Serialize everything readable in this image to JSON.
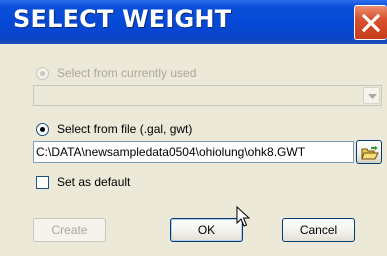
{
  "window": {
    "title": "SELECT WEIGHT"
  },
  "options": {
    "currently_used_label": "Select from currently used",
    "currently_used_value": "",
    "from_file_label": "Select from file (.gal, gwt)",
    "file_path": "C:\\DATA\\newsampledata0504\\ohiolung\\ohk8.GWT",
    "selected_option": "from_file"
  },
  "default_checkbox": {
    "label": "Set as default",
    "checked": false
  },
  "buttons": {
    "create": "Create",
    "ok": "OK",
    "cancel": "Cancel"
  },
  "icons": {
    "close": "close-icon",
    "dropdown": "chevron-down-icon",
    "browse": "folder-open-icon",
    "cursor": "mouse-pointer-icon"
  },
  "colors": {
    "title_bar": "#0548d6",
    "close_button": "#d9502e",
    "dialog_background": "#ece9d8",
    "radio_selected": "#21a121",
    "disabled_text": "#aca899"
  }
}
